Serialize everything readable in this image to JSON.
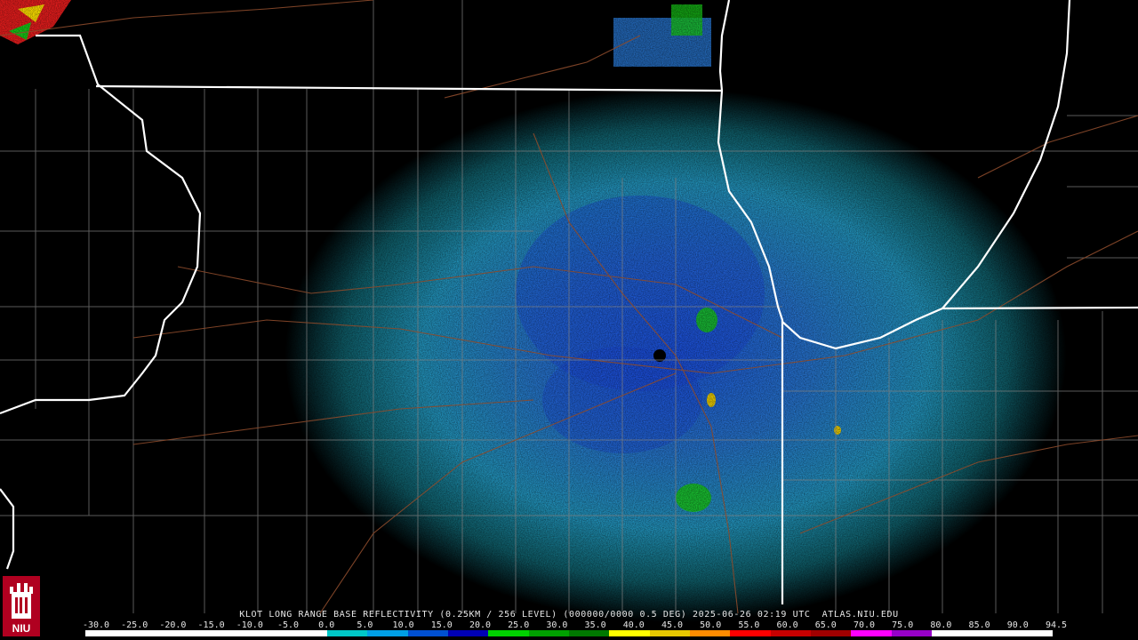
{
  "product": {
    "caption": "KLOT LONG RANGE BASE REFLECTIVITY (0.25KM / 256 LEVEL) (000000/0000 0.5 DEG) 2025-06-26 02:19 UTC  ATLAS.NIU.EDU"
  },
  "scale": {
    "labels": [
      "-30.0",
      "-25.0",
      "-20.0",
      "-15.0",
      "-10.0",
      "-5.0",
      "0.0",
      "5.0",
      "10.0",
      "15.0",
      "20.0",
      "25.0",
      "30.0",
      "35.0",
      "40.0",
      "45.0",
      "50.0",
      "55.0",
      "60.0",
      "65.0",
      "70.0",
      "75.0",
      "80.0",
      "85.0",
      "90.0",
      "94.5"
    ],
    "colors": [
      "#ffffff",
      "#ffffff",
      "#ffffff",
      "#ffffff",
      "#ffffff",
      "#ffffff",
      "#00c8c8",
      "#00a0e6",
      "#0050d2",
      "#0000b4",
      "#00d200",
      "#00a000",
      "#007800",
      "#ffff00",
      "#e6c800",
      "#ff8c00",
      "#ff0000",
      "#c80000",
      "#a00000",
      "#ff00ff",
      "#9600c8",
      "#ffffff",
      "#ffffff",
      "#ffffff"
    ]
  },
  "logo": {
    "text": "NIU",
    "icon": "castle-tower-icon"
  },
  "colors": {
    "background": "#000000",
    "state_border": "#ffffff",
    "county_border": "#808080",
    "roads": "#8b4a2b"
  }
}
